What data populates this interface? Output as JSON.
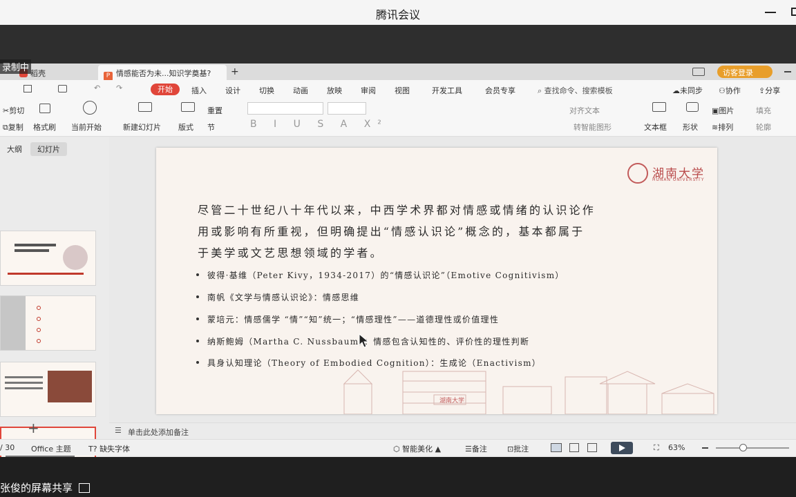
{
  "app": {
    "title": "腾讯会议",
    "recording": "录制中",
    "share_label": "张俊的屏幕共享"
  },
  "wps": {
    "tabs": [
      "稻壳",
      "情感能否为未...知识学奠基?"
    ],
    "visitor_login": "访客登录",
    "menu": [
      "开始",
      "插入",
      "设计",
      "切换",
      "动画",
      "放映",
      "审阅",
      "视图",
      "开发工具",
      "会员专享"
    ],
    "search_placeholder": "查找命令、搜索模板",
    "right_menu": [
      "未同步",
      "协作",
      "分享"
    ],
    "toolbar": {
      "cut": "剪切",
      "copy": "复制",
      "format_painter": "格式刷",
      "play_from_current": "当前开始",
      "new_slide": "新建幻灯片",
      "layout": "版式",
      "reset": "重置",
      "section": "节",
      "align_text": "对齐文本",
      "convert_smartart": "转智能图形",
      "textbox": "文本框",
      "shape": "形状",
      "picture": "图片",
      "arrange": "排列",
      "fill": "填充",
      "outline": "轮廓"
    },
    "panel_tabs": [
      "大纲",
      "幻灯片"
    ],
    "notes_placeholder": "单击此处添加备注",
    "status": {
      "page": "/ 30",
      "theme": "Office 主题",
      "missing_font": "缺失字体",
      "beautify": "智能美化",
      "notes": "备注",
      "comment": "批注",
      "zoom": "63%"
    }
  },
  "slide": {
    "logo_text": "湖南大学",
    "logo_sub": "HUNAN UNIVERSITY",
    "paragraph": [
      "尽管二十世纪八十年代以来，中西学术界都对情感或情绪的认识论作",
      "用或影响有所重视，但明确提出“情感认识论”概念的，基本都属于",
      "于美学或文艺思想领域的学者。"
    ],
    "bullets": [
      "彼得·基维（Peter Kivy，1934-2017）的“情感认识论”（Emotive Cognitivism）",
      "南帆《文学与情感认识论》：情感思维",
      "蒙培元：情感儒学 “情”“知”统一；“情感理性”——道德理性或价值理性",
      "纳斯鲍姆（Martha C. Nussbaum）：情感包含认知性的、评价性的理性判断",
      "具身认知理论（Theory of Embodied Cognition）：生成论（Enactivism）"
    ],
    "stamp": "湖南大学"
  }
}
